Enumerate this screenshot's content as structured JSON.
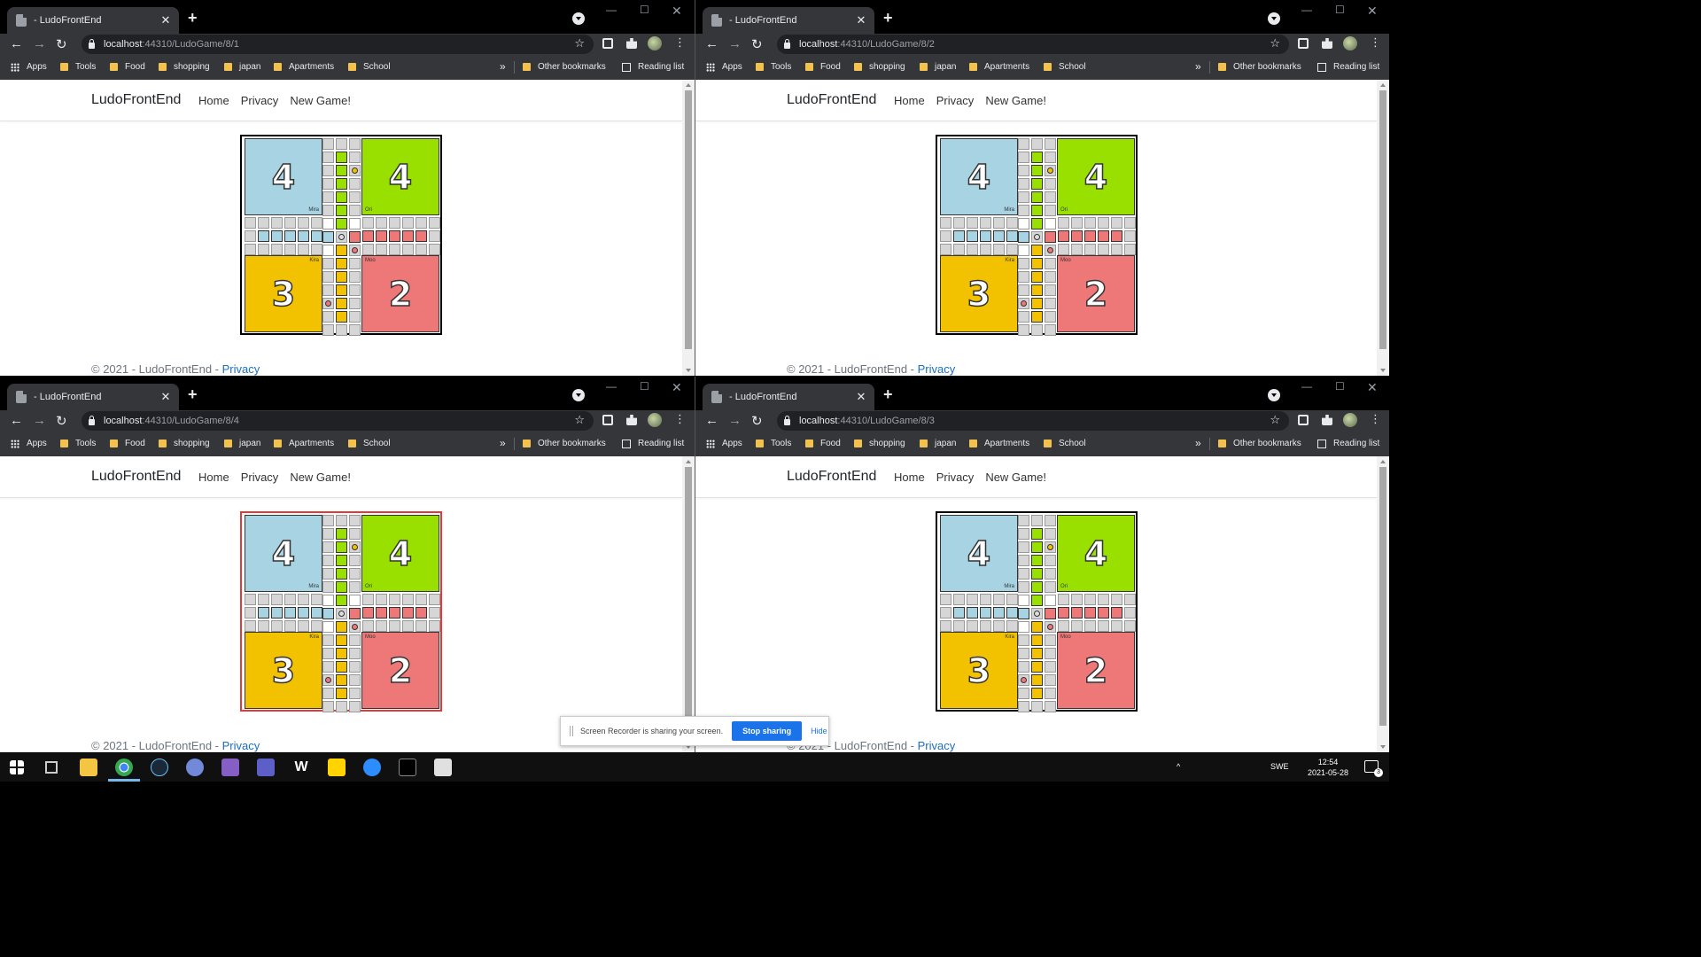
{
  "windows": [
    {
      "id": "tl",
      "tab_title": "- LudoFrontEnd",
      "url_host": "localhost",
      "url_path": ":44310/LudoGame/8/1",
      "selected": false
    },
    {
      "id": "tr",
      "tab_title": "- LudoFrontEnd",
      "url_host": "localhost",
      "url_path": ":44310/LudoGame/8/2",
      "selected": false
    },
    {
      "id": "bl",
      "tab_title": "- LudoFrontEnd",
      "url_host": "localhost",
      "url_path": ":44310/LudoGame/8/4",
      "selected": true
    },
    {
      "id": "br",
      "tab_title": "- LudoFrontEnd",
      "url_host": "localhost",
      "url_path": ":44310/LudoGame/8/3",
      "selected": false
    }
  ],
  "bookmarks": {
    "apps": "Apps",
    "items": [
      "Tools",
      "Food",
      "shopping",
      "japan",
      "Apartments",
      "School"
    ],
    "more": "»",
    "other": "Other bookmarks",
    "reading_list": "Reading list"
  },
  "site": {
    "brand": "LudoFrontEnd",
    "nav": [
      "Home",
      "Privacy",
      "New Game!"
    ],
    "footer_text": "© 2021 - LudoFrontEnd - ",
    "footer_link": "Privacy"
  },
  "board": {
    "homes": [
      {
        "color": "blue",
        "count": "4",
        "player": "Mira"
      },
      {
        "color": "green",
        "count": "4",
        "player": "Ori"
      },
      {
        "color": "yellow",
        "count": "3",
        "player": "Kira"
      },
      {
        "color": "red",
        "count": "2",
        "player": "Moo"
      }
    ],
    "colors": {
      "blue": "#a7d3e3",
      "green": "#99e000",
      "yellow": "#f2c200",
      "red": "#ee7777"
    }
  },
  "share_bar": {
    "message": "Screen Recorder is sharing your screen.",
    "stop": "Stop sharing",
    "hide": "Hide"
  },
  "taskbar": {
    "language": "SWE",
    "time": "12:54",
    "date": "2021-05-28",
    "notifications": "3"
  }
}
